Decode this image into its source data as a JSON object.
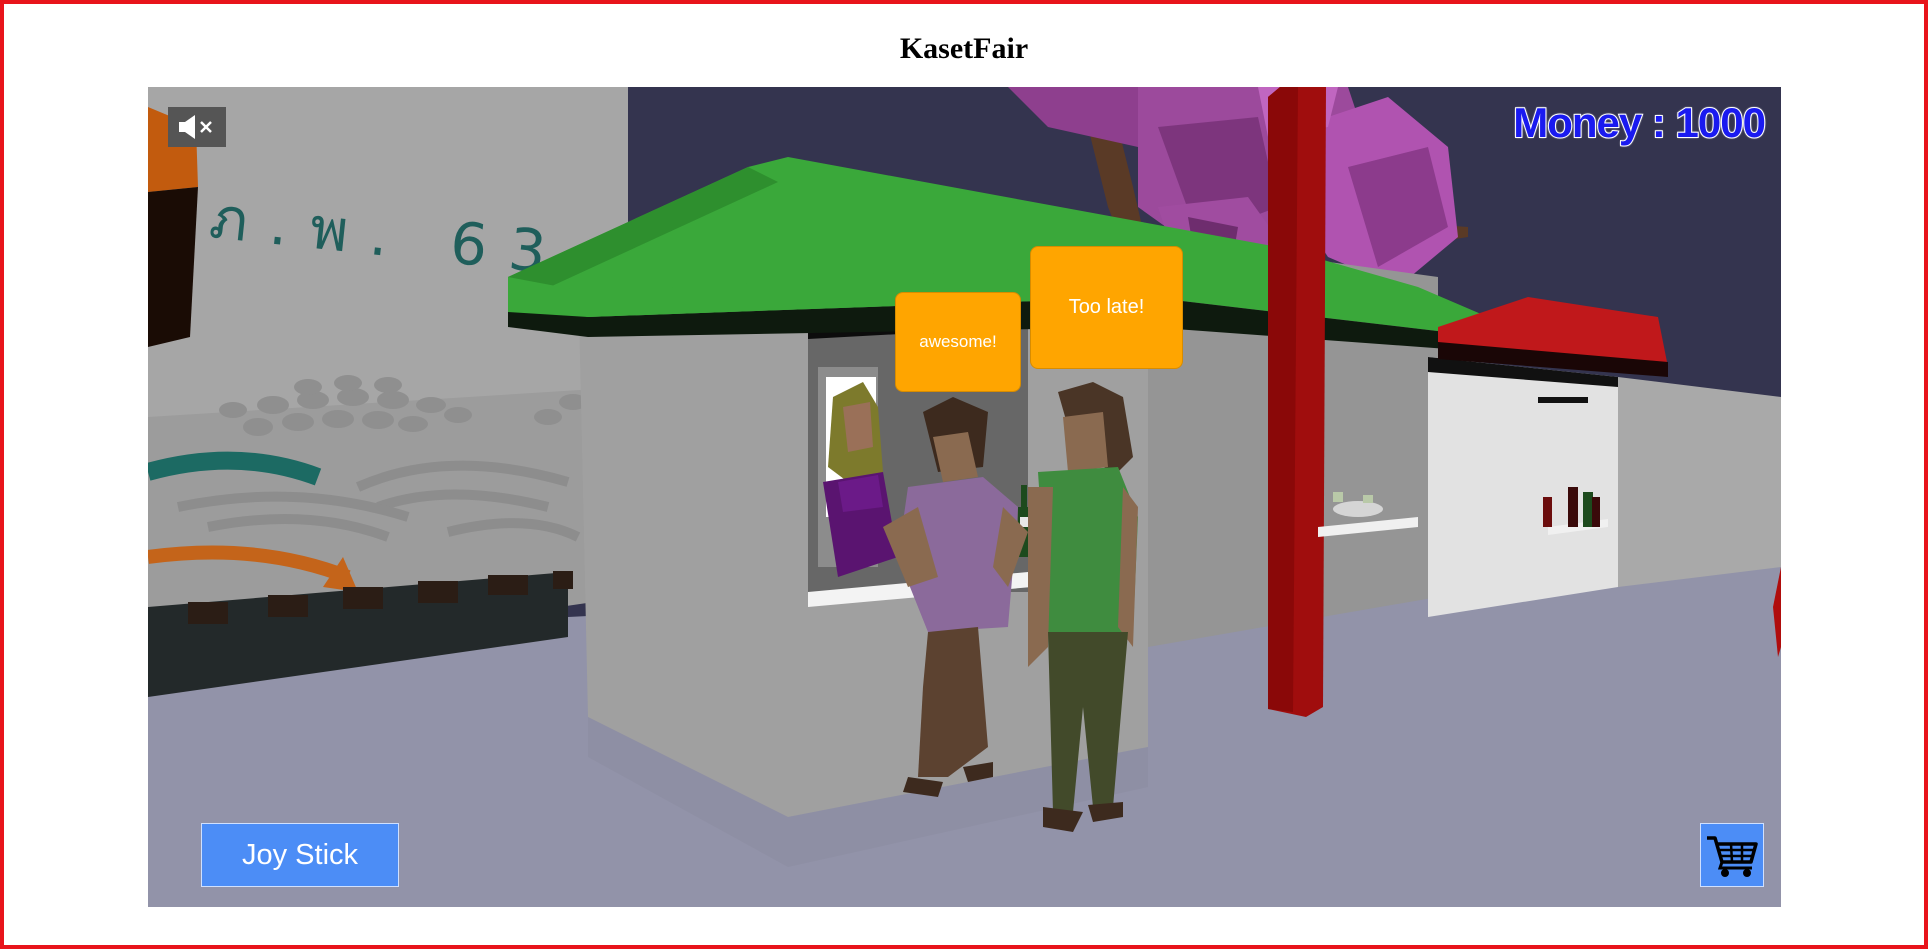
{
  "page": {
    "title": "KasetFair"
  },
  "hud": {
    "money_label": "Money : 1000",
    "mute_icon": "speaker-muted-icon",
    "cart_icon": "shopping-cart-icon"
  },
  "controls": {
    "joystick_label": "Joy Stick"
  },
  "speech_bubbles": [
    {
      "text": "awesome!"
    },
    {
      "text": "Too late!"
    }
  ],
  "scene": {
    "wall_text": "ภ.พ. 63"
  },
  "colors": {
    "page_border": "#e8141b",
    "money_text": "#1a1af0",
    "bubble": "#ffa500",
    "button": "#4c8df6",
    "roof_green": "#3aa83a",
    "roof_red": "#c0181b",
    "pillar": "#a00d0d",
    "sky": "#34344f",
    "ground": "#8f90a6",
    "tree": "#a84aa8"
  }
}
